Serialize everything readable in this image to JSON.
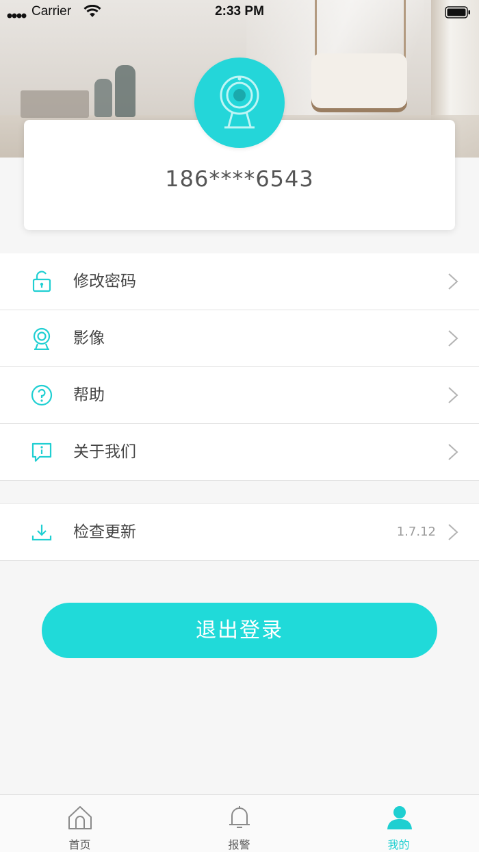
{
  "status_bar": {
    "carrier": "Carrier",
    "time": "2:33 PM"
  },
  "profile": {
    "phone": "186****6543"
  },
  "menu": {
    "items": [
      {
        "label": "修改密码",
        "icon": "unlock-icon"
      },
      {
        "label": "影像",
        "icon": "webcam-icon"
      },
      {
        "label": "帮助",
        "icon": "help-circle-icon"
      },
      {
        "label": "关于我们",
        "icon": "info-chat-icon"
      }
    ],
    "update": {
      "label": "检查更新",
      "version": "1.7.12",
      "icon": "download-icon"
    }
  },
  "logout": {
    "label": "退出登录"
  },
  "tabs": [
    {
      "label": "首页",
      "icon": "home-icon",
      "active": false
    },
    {
      "label": "报警",
      "icon": "bell-icon",
      "active": false
    },
    {
      "label": "我的",
      "icon": "user-icon",
      "active": true
    }
  ],
  "colors": {
    "accent": "#20dad9",
    "text": "#444444",
    "muted": "#9b9b9b",
    "background": "#f6f6f6"
  }
}
